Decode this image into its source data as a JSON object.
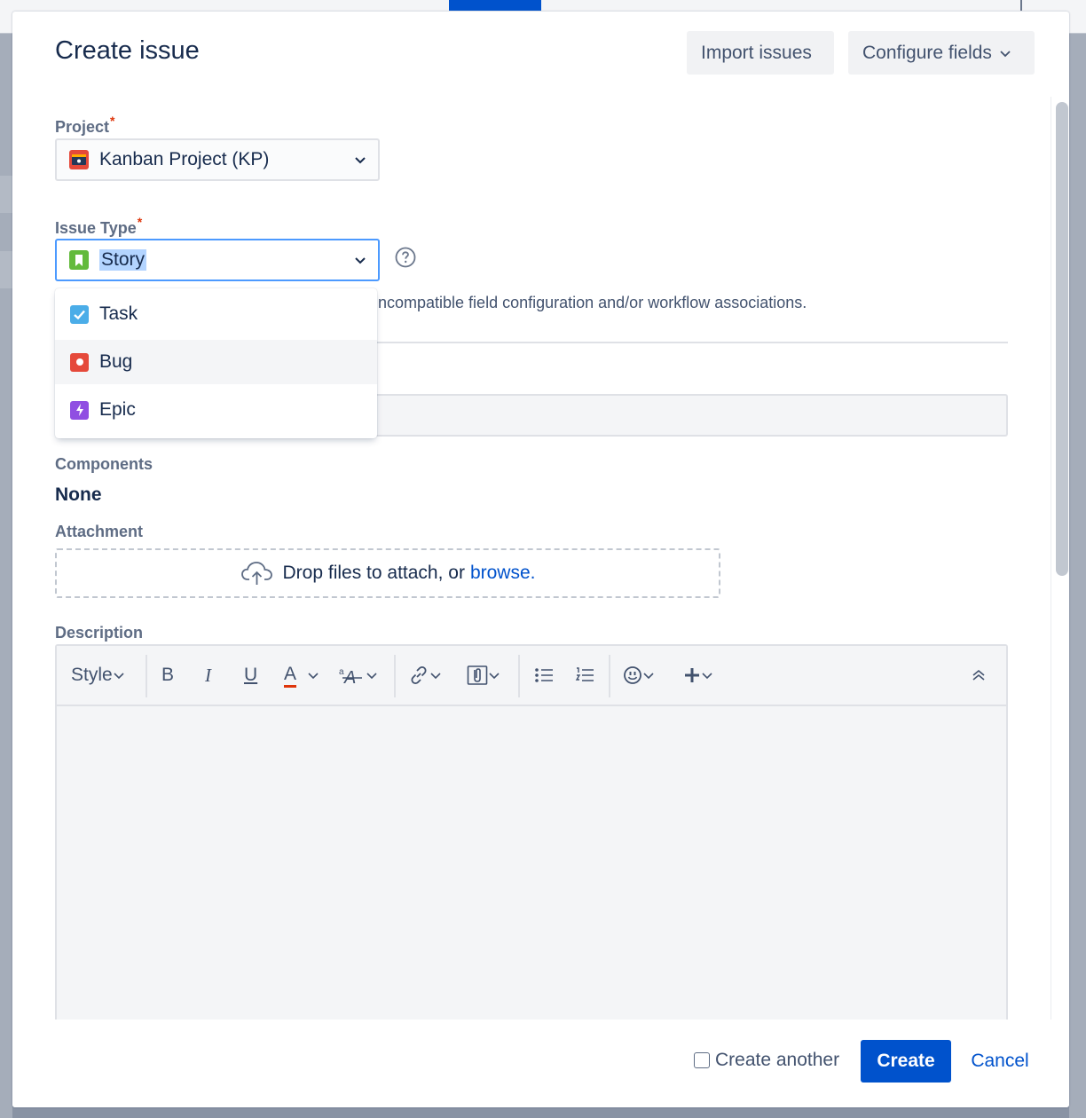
{
  "modal": {
    "title": "Create issue",
    "import_label": "Import issues",
    "configure_label": "Configure fields"
  },
  "project": {
    "label": "Project",
    "required": "*",
    "value": "Kanban Project (KP)"
  },
  "issue_type": {
    "label": "Issue Type",
    "required": "*",
    "value": "Story",
    "options": [
      {
        "label": "Task",
        "color": "#4bade8"
      },
      {
        "label": "Bug",
        "color": "#e5493a"
      },
      {
        "label": "Epic",
        "color": "#904ee2"
      }
    ],
    "story_color": "#63ba3c",
    "warning": "ncompatible field configuration and/or workflow associations."
  },
  "components": {
    "label": "Components",
    "value": "None"
  },
  "attachment": {
    "label": "Attachment",
    "text": "Drop files to attach, or",
    "link": "browse."
  },
  "description": {
    "label": "Description",
    "toolbar": {
      "style": "Style",
      "bold": "B",
      "italic": "I",
      "underline": "U",
      "text_color": "A"
    }
  },
  "footer": {
    "create_another": "Create another",
    "create_label": "Create",
    "cancel_label": "Cancel"
  },
  "colors": {
    "primary": "#0052cc",
    "focus": "#4c9aff",
    "required": "#de350b"
  }
}
